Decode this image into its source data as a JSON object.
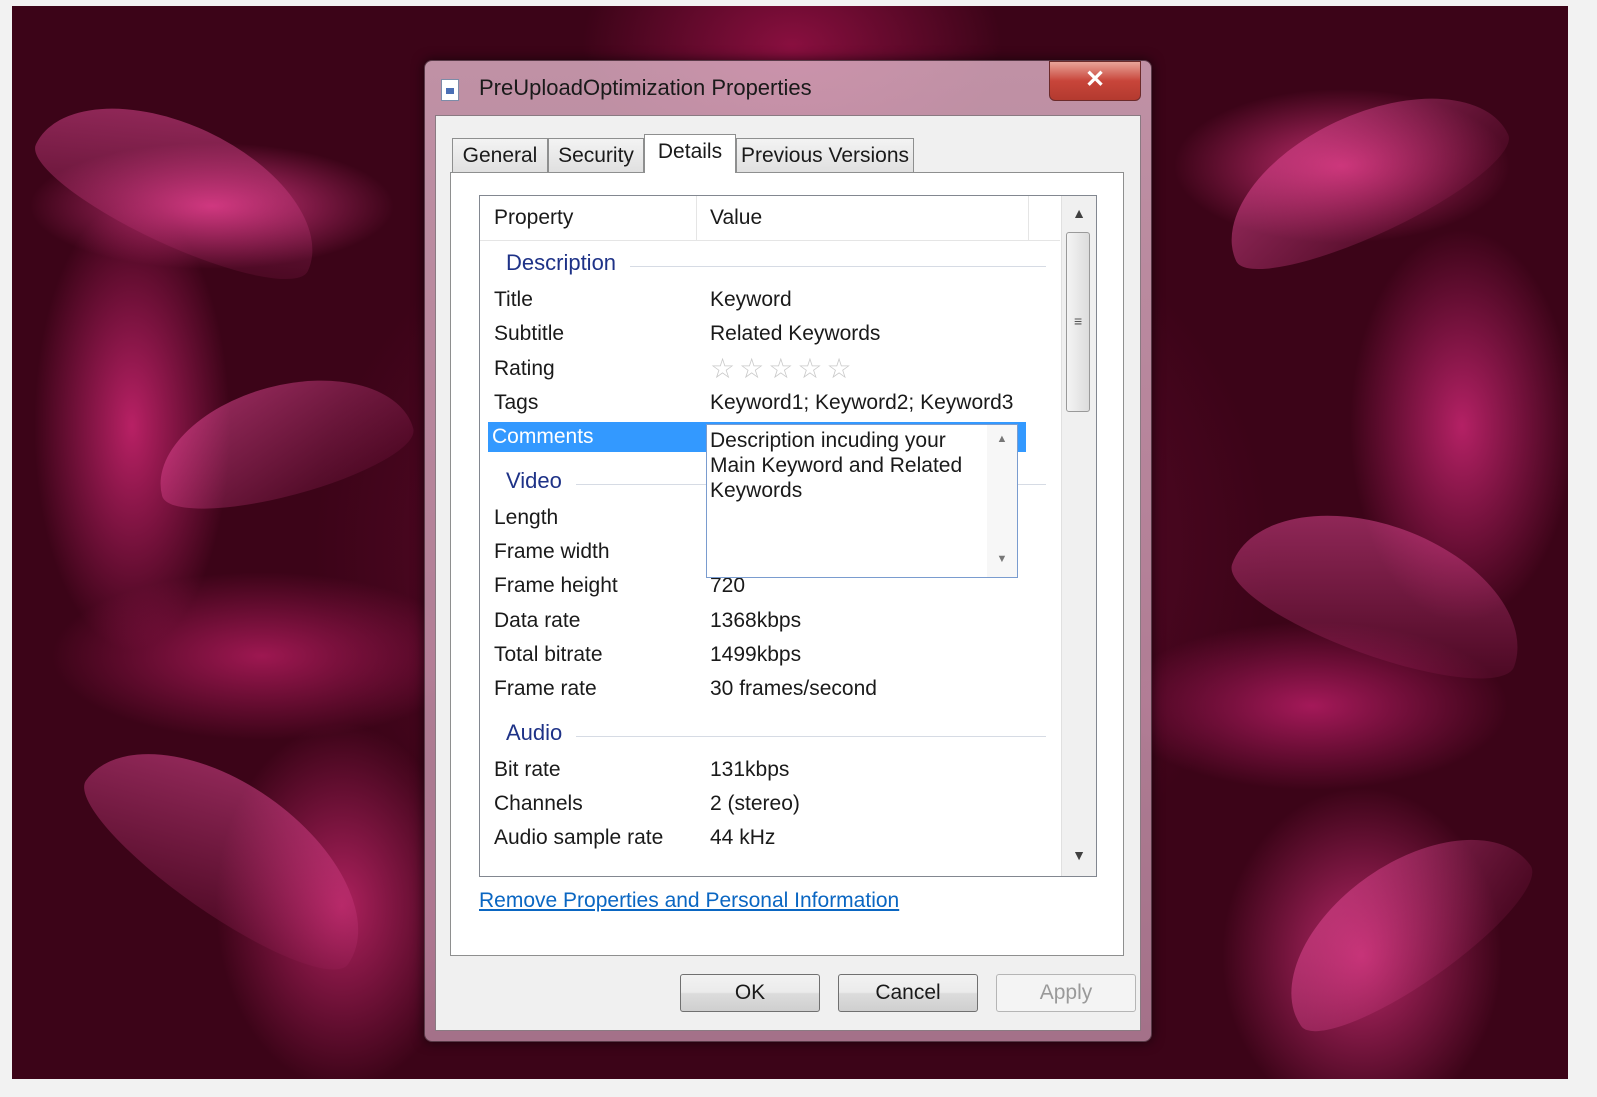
{
  "window": {
    "title": "PreUploadOptimization Properties",
    "close_glyph": "✕",
    "icon": "document-icon"
  },
  "tabs": [
    {
      "label": "General"
    },
    {
      "label": "Security"
    },
    {
      "label": "Details"
    },
    {
      "label": "Previous Versions"
    }
  ],
  "active_tab": "Details",
  "list": {
    "header": {
      "property": "Property",
      "value": "Value"
    },
    "groups": {
      "description": "Description",
      "video": "Video",
      "audio": "Audio"
    },
    "description_rows": [
      {
        "property": "Title",
        "value": "Keyword"
      },
      {
        "property": "Subtitle",
        "value": "Related Keywords"
      },
      {
        "property": "Rating",
        "value": ""
      },
      {
        "property": "Tags",
        "value": "Keyword1; Keyword2; Keyword3"
      },
      {
        "property": "Comments",
        "value": ""
      }
    ],
    "rating_stars": 0,
    "rating_max": 5,
    "comments_editor_text": "Description incuding your Main Keyword and Related Keywords",
    "video_rows": [
      {
        "property": "Length",
        "value": ""
      },
      {
        "property": "Frame width",
        "value": ""
      },
      {
        "property": "Frame height",
        "value": "720"
      },
      {
        "property": "Data rate",
        "value": "1368kbps"
      },
      {
        "property": "Total bitrate",
        "value": "1499kbps"
      },
      {
        "property": "Frame rate",
        "value": "30 frames/second"
      }
    ],
    "audio_rows": [
      {
        "property": "Bit rate",
        "value": "131kbps"
      },
      {
        "property": "Channels",
        "value": "2 (stereo)"
      },
      {
        "property": "Audio sample rate",
        "value": "44 kHz"
      }
    ]
  },
  "link": "Remove Properties and Personal Information",
  "buttons": {
    "ok": "OK",
    "cancel": "Cancel",
    "apply": "Apply"
  },
  "colors": {
    "selection": "#3399ff",
    "group_header": "#1e3287",
    "link": "#0a66c2"
  }
}
